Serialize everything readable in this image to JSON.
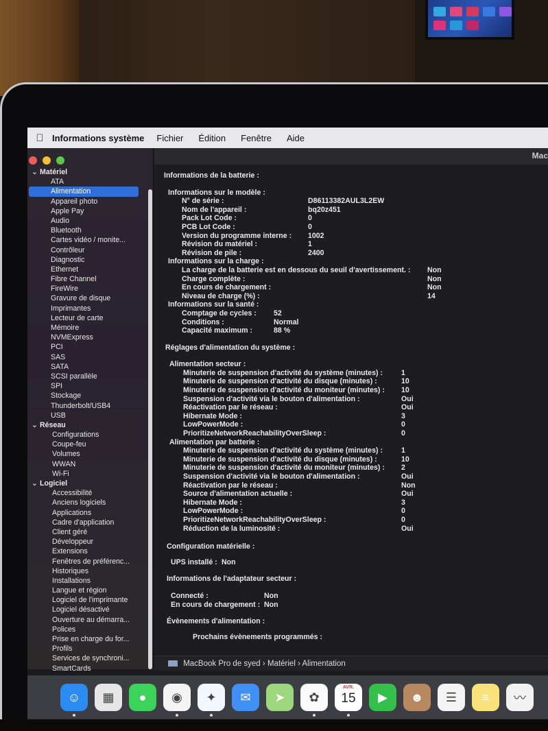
{
  "menubar": {
    "app_name": "Informations système",
    "menus": [
      "Fichier",
      "Édition",
      "Fenêtre",
      "Aide"
    ]
  },
  "window": {
    "title_fragment": "Mac"
  },
  "sidebar": {
    "groups": [
      {
        "label": "Matériel",
        "items": [
          "ATA",
          "Alimentation",
          "Appareil photo",
          "Apple Pay",
          "Audio",
          "Bluetooth",
          "Cartes vidéo / monite...",
          "Contrôleur",
          "Diagnostic",
          "Ethernet",
          "Fibre Channel",
          "FireWire",
          "Gravure de disque",
          "Imprimantes",
          "Lecteur de carte",
          "Mémoire",
          "NVMExpress",
          "PCI",
          "SAS",
          "SATA",
          "SCSI parallèle",
          "SPI",
          "Stockage",
          "Thunderbolt/USB4",
          "USB"
        ]
      },
      {
        "label": "Réseau",
        "items": [
          "Configurations",
          "Coupe-feu",
          "Volumes",
          "WWAN",
          "Wi-Fi"
        ]
      },
      {
        "label": "Logiciel",
        "items": [
          "Accessibilité",
          "Anciens logiciels",
          "Applications",
          "Cadre d'application",
          "Client géré",
          "Développeur",
          "Extensions",
          "Fenêtres de préférenc...",
          "Historiques",
          "Installations",
          "Langue et région",
          "Logiciel de l'imprimante",
          "Logiciel désactivé",
          "Ouverture au démarra...",
          "Polices",
          "Prise en charge du for...",
          "Profils",
          "Services de synchroni...",
          "SmartCards"
        ]
      }
    ],
    "selected": "Alimentation"
  },
  "detail": {
    "battery_title": "Informations de la batterie :",
    "model_title": "Informations sur le modèle :",
    "model": [
      [
        "N° de série :",
        "D86113382AUL3L2EW"
      ],
      [
        "Nom de l'appareil :",
        "bq20z451"
      ],
      [
        "Pack Lot Code :",
        "0"
      ],
      [
        "PCB Lot Code :",
        "0"
      ],
      [
        "Version du programme interne :",
        "1002"
      ],
      [
        "Révision du matériel :",
        "1"
      ],
      [
        "Révision de pile :",
        "2400"
      ]
    ],
    "charge_title": "Informations sur la charge :",
    "charge": [
      [
        "La charge de la batterie est en dessous du seuil d'avertissement. :",
        "Non"
      ],
      [
        "Charge complète :",
        "Non"
      ],
      [
        "En cours de chargement :",
        "Non"
      ],
      [
        "Niveau de charge (%) :",
        "14"
      ]
    ],
    "health_title": "Informations sur la santé :",
    "health": [
      [
        "Comptage de cycles :",
        "52"
      ],
      [
        "Conditions :",
        "Normal"
      ],
      [
        "Capacité maximum :",
        "88 %"
      ]
    ],
    "power_title": "Réglages d'alimentation du système :",
    "ac_title": "Alimentation secteur :",
    "ac": [
      [
        "Minuterie de suspension d'activité du système (minutes) :",
        "1"
      ],
      [
        "Minuterie de suspension d'activité du disque (minutes) :",
        "10"
      ],
      [
        "Minuterie de suspension d'activité du moniteur (minutes) :",
        "10"
      ],
      [
        "Suspension d'activité via le bouton d'alimentation :",
        "Oui"
      ],
      [
        "Réactivation par le réseau :",
        "Oui"
      ],
      [
        "Hibernate Mode :",
        "3"
      ],
      [
        "LowPowerMode :",
        "0"
      ],
      [
        "PrioritizeNetworkReachabilityOverSleep :",
        "0"
      ]
    ],
    "batt_title": "Alimentation par batterie :",
    "batt": [
      [
        "Minuterie de suspension d'activité du système (minutes) :",
        "1"
      ],
      [
        "Minuterie de suspension d'activité du disque (minutes) :",
        "10"
      ],
      [
        "Minuterie de suspension d'activité du moniteur (minutes) :",
        "2"
      ],
      [
        "Suspension d'activité via le bouton d'alimentation :",
        "Oui"
      ],
      [
        "Réactivation par le réseau :",
        "Non"
      ],
      [
        "Source d'alimentation actuelle :",
        "Oui"
      ],
      [
        "Hibernate Mode :",
        "3"
      ],
      [
        "LowPowerMode :",
        "0"
      ],
      [
        "PrioritizeNetworkReachabilityOverSleep :",
        "0"
      ],
      [
        "Réduction de la luminosité :",
        "Oui"
      ]
    ],
    "hw_title": "Configuration matérielle :",
    "ups_label": "UPS installé :",
    "ups_value": "Non",
    "adapter_title": "Informations de l'adaptateur secteur :",
    "adapter": [
      [
        "Connecté :",
        "Non"
      ],
      [
        "En cours de chargement :",
        "Non"
      ]
    ],
    "events_title": "Évènements d'alimentation :",
    "scheduled_title": "Prochains évènements programmés :"
  },
  "pathbar": {
    "items": [
      "MacBook Pro de syed",
      "Matériel",
      "Alimentation"
    ],
    "separator": "›"
  },
  "dock": {
    "calendar_month": "AVR.",
    "calendar_day": "15",
    "apps": [
      {
        "name": "finder",
        "color": "#2a8bf0",
        "glyph": "☺"
      },
      {
        "name": "launchpad",
        "color": "#e6e6e6",
        "glyph": "▦"
      },
      {
        "name": "messages",
        "color": "#3bd35a",
        "glyph": "●"
      },
      {
        "name": "chrome",
        "color": "#f4f4f4",
        "glyph": "◉"
      },
      {
        "name": "safari",
        "color": "#f3f7ff",
        "glyph": "✦"
      },
      {
        "name": "mail",
        "color": "#3f8ff5",
        "glyph": "✉"
      },
      {
        "name": "maps",
        "color": "#9cd67d",
        "glyph": "➤"
      },
      {
        "name": "photos",
        "color": "#fafafa",
        "glyph": "✿"
      },
      {
        "name": "calendar",
        "color": "#ffffff",
        "glyph": ""
      },
      {
        "name": "facetime",
        "color": "#35c04b",
        "glyph": "▶"
      },
      {
        "name": "contacts",
        "color": "#b8895e",
        "glyph": "☻"
      },
      {
        "name": "reminders",
        "color": "#f4f4f4",
        "glyph": "☰"
      },
      {
        "name": "notes",
        "color": "#f9e27a",
        "glyph": "≡"
      },
      {
        "name": "freeform",
        "color": "#f2f2f2",
        "glyph": "〰"
      }
    ]
  }
}
